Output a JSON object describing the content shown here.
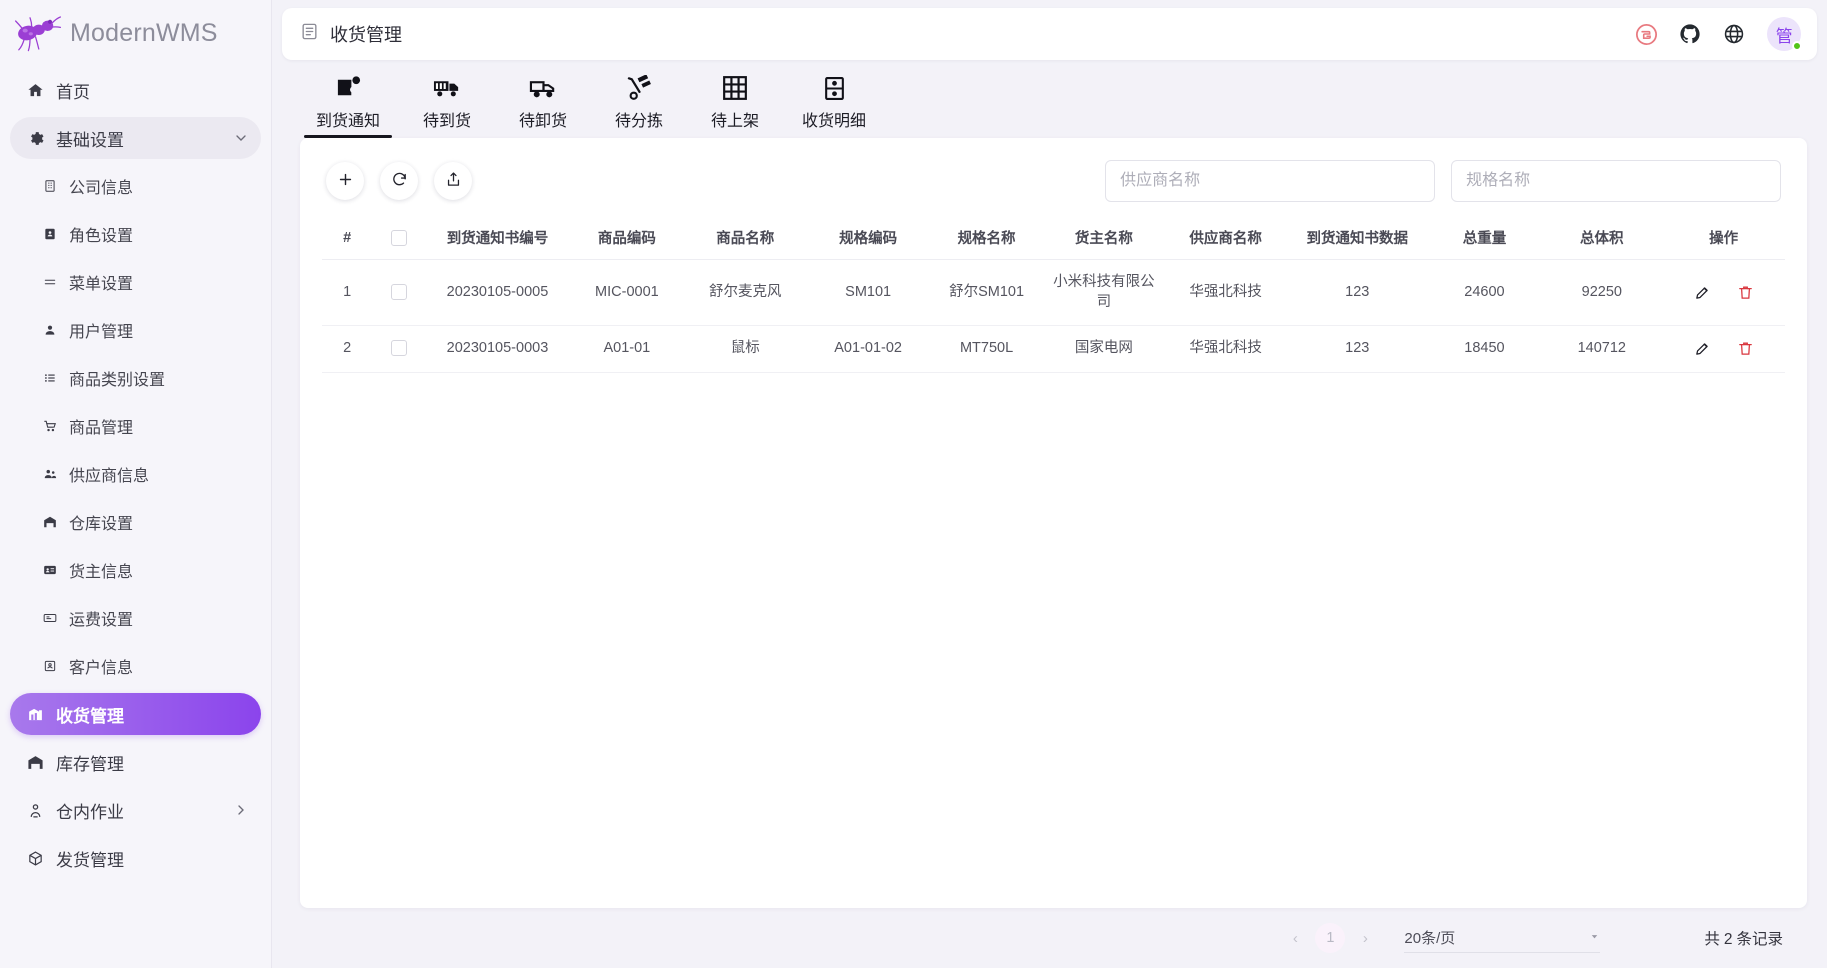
{
  "brand": {
    "name": "ModernWMS",
    "logo_icon": "ant-logo-icon"
  },
  "sidebar": {
    "items": [
      {
        "label": "首页",
        "icon": "home-icon",
        "level": "top",
        "state": "normal"
      },
      {
        "label": "基础设置",
        "icon": "gear-icon",
        "level": "top",
        "state": "group-open",
        "chevron": "chevron-down-icon"
      },
      {
        "label": "公司信息",
        "icon": "building-icon",
        "level": "child",
        "state": "normal"
      },
      {
        "label": "角色设置",
        "icon": "id-badge-icon",
        "level": "child",
        "state": "normal"
      },
      {
        "label": "菜单设置",
        "icon": "menu-list-icon",
        "level": "child",
        "state": "normal"
      },
      {
        "label": "用户管理",
        "icon": "user-icon",
        "level": "child",
        "state": "normal"
      },
      {
        "label": "商品类别设置",
        "icon": "category-list-icon",
        "level": "child",
        "state": "normal"
      },
      {
        "label": "商品管理",
        "icon": "cart-icon",
        "level": "child",
        "state": "normal"
      },
      {
        "label": "供应商信息",
        "icon": "user-group-icon",
        "level": "child",
        "state": "normal"
      },
      {
        "label": "仓库设置",
        "icon": "warehouse-icon",
        "level": "child",
        "state": "normal"
      },
      {
        "label": "货主信息",
        "icon": "owner-card-icon",
        "level": "child",
        "state": "normal"
      },
      {
        "label": "运费设置",
        "icon": "freight-icon",
        "level": "child",
        "state": "normal"
      },
      {
        "label": "客户信息",
        "icon": "customer-card-icon",
        "level": "child",
        "state": "normal"
      },
      {
        "label": "收货管理",
        "icon": "receiving-icon",
        "level": "top",
        "state": "active"
      },
      {
        "label": "库存管理",
        "icon": "warehouse-icon",
        "level": "top",
        "state": "normal"
      },
      {
        "label": "仓内作业",
        "icon": "worker-icon",
        "level": "top",
        "state": "normal",
        "chevron": "chevron-right-icon"
      },
      {
        "label": "发货管理",
        "icon": "shipping-icon",
        "level": "top",
        "state": "normal"
      }
    ]
  },
  "topbar": {
    "title": "收货管理",
    "title_icon": "document-list-icon",
    "actions": [
      {
        "name": "gitee-icon",
        "label": "Gitee"
      },
      {
        "name": "github-icon",
        "label": "GitHub"
      },
      {
        "name": "globe-icon",
        "label": "语言"
      }
    ],
    "avatar_text": "管",
    "avatar_status": "online"
  },
  "tabs": [
    {
      "label": "到货通知",
      "icon": "arrival-notice-icon",
      "active": true
    },
    {
      "label": "待到货",
      "icon": "truck-box-icon",
      "active": false
    },
    {
      "label": "待卸货",
      "icon": "truck-icon",
      "active": false
    },
    {
      "label": "待分拣",
      "icon": "hand-truck-icon",
      "active": false
    },
    {
      "label": "待上架",
      "icon": "grid-shelf-icon",
      "active": false
    },
    {
      "label": "收货明细",
      "icon": "detail-list-icon",
      "active": false
    }
  ],
  "toolbar": {
    "add_label": "+",
    "buttons": [
      {
        "name": "add-button",
        "icon": "plus-icon"
      },
      {
        "name": "refresh-button",
        "icon": "refresh-icon"
      },
      {
        "name": "export-button",
        "icon": "export-icon"
      }
    ]
  },
  "search": {
    "supplier_placeholder": "供应商名称",
    "supplier_value": "",
    "spec_placeholder": "规格名称",
    "spec_value": ""
  },
  "table": {
    "headers": [
      "#",
      "",
      "到货通知书编号",
      "商品编码",
      "商品名称",
      "规格编码",
      "规格名称",
      "货主名称",
      "供应商名称",
      "到货通知书数据",
      "总重量",
      "总体积",
      "操作"
    ],
    "rows": [
      {
        "index": "1",
        "notice_no": "20230105-0005",
        "goods_code": "MIC-0001",
        "goods_name": "舒尔麦克风",
        "spec_code": "SM101",
        "spec_name": "舒尔SM101",
        "owner_name": "小米科技有限公司",
        "supplier_name": "华强北科技",
        "notice_data": "123",
        "total_weight": "24600",
        "total_volume": "92250"
      },
      {
        "index": "2",
        "notice_no": "20230105-0003",
        "goods_code": "A01-01",
        "goods_name": "鼠标",
        "spec_code": "A01-01-02",
        "spec_name": "MT750L",
        "owner_name": "国家电网",
        "supplier_name": "华强北科技",
        "notice_data": "123",
        "total_weight": "18450",
        "total_volume": "140712"
      }
    ],
    "row_actions": [
      {
        "name": "edit-row-button",
        "icon": "pencil-icon"
      },
      {
        "name": "delete-row-button",
        "icon": "trash-icon"
      }
    ]
  },
  "pagination": {
    "prev": "‹",
    "next": "›",
    "current_page": "1",
    "page_size": "20条/页",
    "total_prefix": "共",
    "total_count": "2",
    "total_suffix": "条记录"
  },
  "colors": {
    "accent_start": "#a879ec",
    "accent_end": "#8b44ec",
    "brand_purple": "#9b3fd4",
    "danger": "#d9363e",
    "online": "#52c41a",
    "page_bg": "#f3f2f8",
    "sidebar_bg": "#f6f5fa"
  }
}
